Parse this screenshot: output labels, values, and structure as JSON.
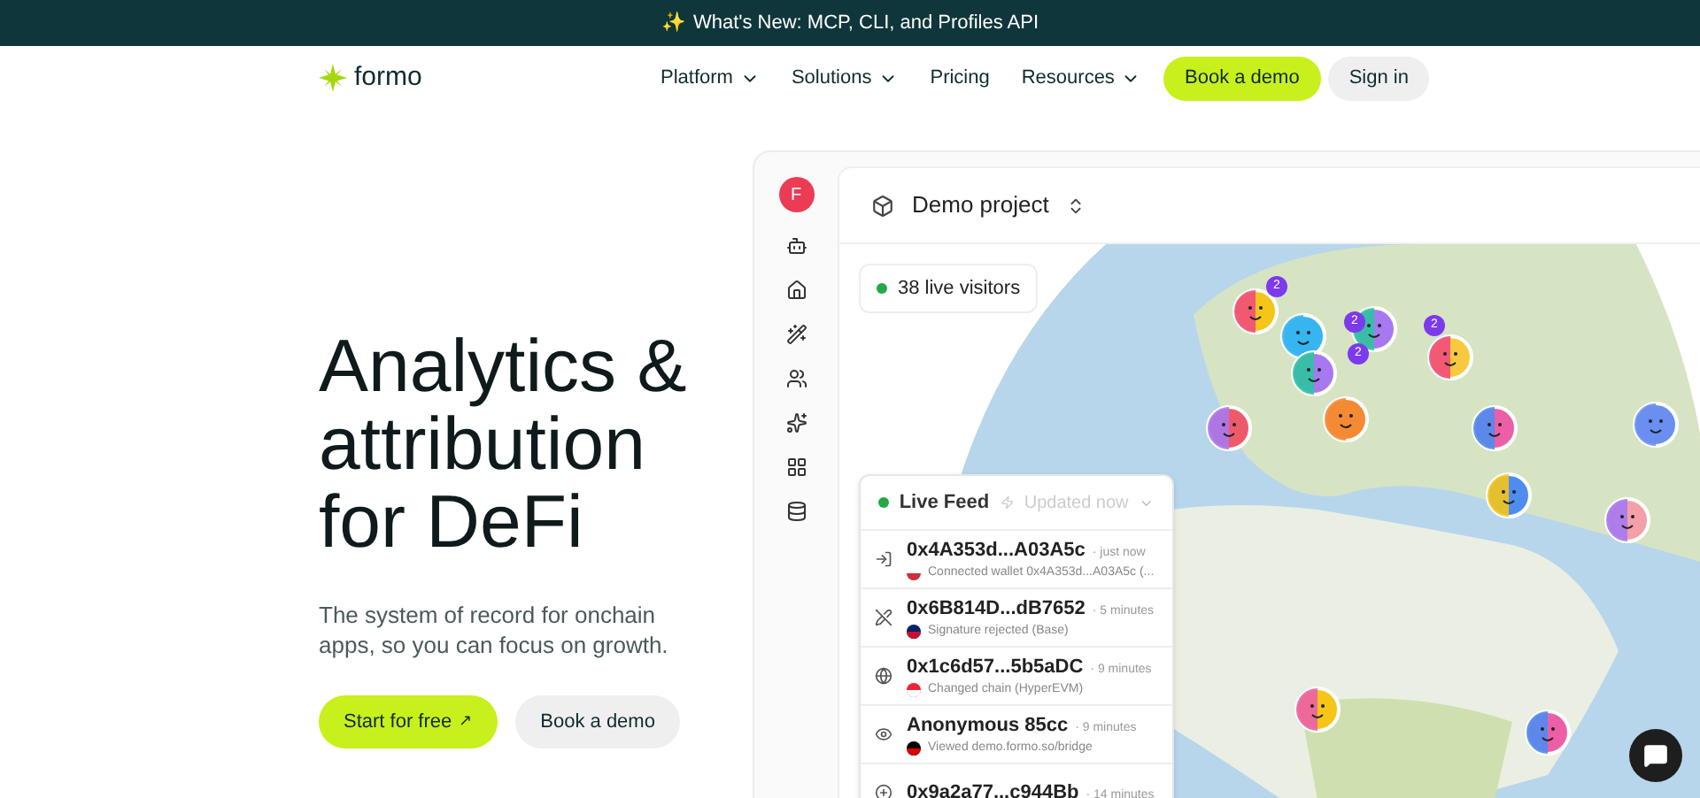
{
  "banner": {
    "icon": "✨",
    "text": "What's New: MCP, CLI, and Profiles API"
  },
  "nav": {
    "brand": "formo",
    "links": [
      {
        "label": "Platform",
        "dropdown": true
      },
      {
        "label": "Solutions",
        "dropdown": true
      },
      {
        "label": "Pricing",
        "dropdown": false
      },
      {
        "label": "Resources",
        "dropdown": true
      }
    ],
    "primary": "Book a demo",
    "secondary": "Sign in"
  },
  "hero": {
    "title": "Analytics & attribution for DeFi",
    "subtitle": "The system of record for onchain apps, so you can focus on growth.",
    "primary": "Start for free",
    "primary_icon": "↗",
    "secondary": "Book a demo"
  },
  "app": {
    "avatar": "F",
    "project": "Demo project",
    "live_visitors": "38 live visitors",
    "map": {
      "clusters": [
        "2",
        "2",
        "2",
        "2"
      ]
    },
    "feed": {
      "title": "Live Feed",
      "updated": "Updated now",
      "items": [
        {
          "kind": "connect",
          "address": "0x4A353d...A03A5c",
          "time": "· just now",
          "event": "Connected wallet 0x4A353d...A03A5c (..."
        },
        {
          "kind": "reject",
          "address": "0x6B814D...dB7652",
          "time": "· 5 minutes",
          "event": "Signature rejected (Base)"
        },
        {
          "kind": "chain",
          "address": "0x1c6d57...5b5aDC",
          "time": "· 9 minutes",
          "event": "Changed chain (HyperEVM)"
        },
        {
          "kind": "view",
          "address": "Anonymous 85cc",
          "time": "· 9 minutes",
          "event": "Viewed demo.formo.so/bridge"
        },
        {
          "kind": "other",
          "address": "0x9a2a77...c944Bb",
          "time": "· 14 minutes"
        }
      ]
    }
  }
}
